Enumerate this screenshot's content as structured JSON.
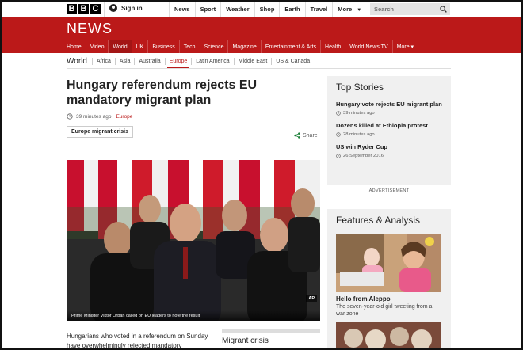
{
  "topbar": {
    "logo_letters": [
      "B",
      "B",
      "C"
    ],
    "sign_in": "Sign in",
    "nav": [
      "News",
      "Sport",
      "Weather",
      "Shop",
      "Earth",
      "Travel",
      "More"
    ],
    "search_placeholder": "Search"
  },
  "header": {
    "title": "NEWS",
    "nav": [
      "Home",
      "Video",
      "World",
      "UK",
      "Business",
      "Tech",
      "Science",
      "Magazine",
      "Entertainment & Arts",
      "Health",
      "World News TV",
      "More ▾"
    ],
    "active_nav": "World",
    "accent_color": "#bb1919"
  },
  "subnav": {
    "section": "World",
    "items": [
      "Africa",
      "Asia",
      "Australia",
      "Europe",
      "Latin America",
      "Middle East",
      "US & Canada"
    ],
    "active": "Europe"
  },
  "article": {
    "headline": "Hungary referendum rejects EU mandatory migrant plan",
    "time": "39 minutes ago",
    "section": "Europe",
    "tag": "Europe migrant crisis",
    "share": "Share",
    "image_caption": "Prime Minister Viktor Orban called on EU leaders to note the result",
    "image_credit": "AP",
    "intro": "Hungarians who voted in a referendum on Sunday have overwhelmingly rejected mandatory",
    "related_title": "Migrant crisis"
  },
  "sidebar": {
    "top_stories_title": "Top Stories",
    "stories": [
      {
        "title": "Hungary vote rejects EU migrant plan",
        "time": "39 minutes ago"
      },
      {
        "title": "Dozens killed at Ethiopia protest",
        "time": "28 minutes ago"
      },
      {
        "title": "US win Ryder Cup",
        "time": "26 September 2016"
      }
    ],
    "advert": "ADVERTISEMENT",
    "features_title": "Features & Analysis",
    "feature": {
      "title": "Hello from Aleppo",
      "desc": "The seven-year-old girl tweeting from a war zone"
    }
  }
}
